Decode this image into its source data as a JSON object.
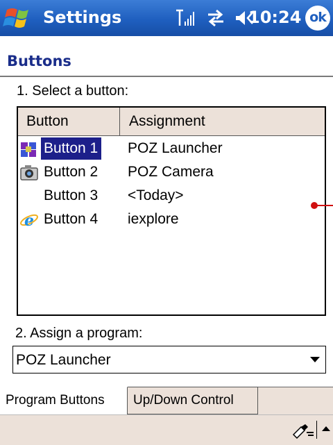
{
  "titlebar": {
    "app_title": "Settings",
    "clock": "10:24",
    "ok_label": "ok",
    "icons": [
      "windows-start-icon",
      "signal-strength-icon",
      "connectivity-icon",
      "volume-icon"
    ]
  },
  "page": {
    "section_title": "Buttons",
    "select_label": "1. Select a button:",
    "assign_label": "2. Assign a program:"
  },
  "listview": {
    "columns": [
      "Button",
      "Assignment"
    ],
    "rows": [
      {
        "name": "Button 1",
        "assignment": "POZ Launcher",
        "icon": "launcher-icon",
        "selected": true
      },
      {
        "name": "Button 2",
        "assignment": "POZ Camera",
        "icon": "camera-icon",
        "selected": false
      },
      {
        "name": "Button 3",
        "assignment": "<Today>",
        "icon": "",
        "selected": false
      },
      {
        "name": "Button 4",
        "assignment": "iexplore",
        "icon": "internet-explorer-icon",
        "selected": false
      }
    ]
  },
  "program_select": {
    "value": "POZ Launcher"
  },
  "tabs": [
    {
      "label": "Program Buttons",
      "active": true
    },
    {
      "label": "Up/Down Control",
      "active": false
    }
  ],
  "commandbar": {
    "icons": [
      "input-panel-icon",
      "input-method-arrow-icon"
    ]
  },
  "colors": {
    "titlebar": "#1f5fbf",
    "selection": "#1c1f8a",
    "section_title": "#1a2d8a",
    "panel_bg": "#ece1d9",
    "callout": "#d01010"
  }
}
